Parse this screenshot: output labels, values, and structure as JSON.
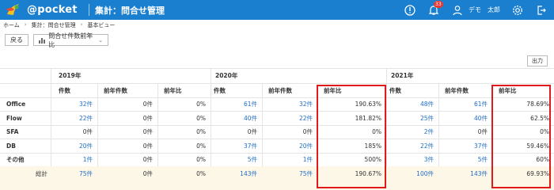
{
  "header": {
    "logo_text": "@pocket",
    "title": "集計：問合せ管理",
    "badge_count": "33",
    "user_name": "デモ　太郎"
  },
  "breadcrumb": [
    "ホーム",
    "集計：問合せ管理",
    "基本ビュー"
  ],
  "toolbar": {
    "back_label": "戻る",
    "dropdown_value": "問合せ件数前年比",
    "export_label": "出力"
  },
  "years": [
    "2019年",
    "2020年",
    "2021年"
  ],
  "column_headers": [
    "件数",
    "前年件数",
    "前年比"
  ],
  "rows": [
    {
      "label": "Office",
      "y2019": [
        "32件",
        "0件",
        "0%"
      ],
      "y2020": [
        "61件",
        "32件",
        "190.63%"
      ],
      "y2021": [
        "48件",
        "61件",
        "78.69%"
      ]
    },
    {
      "label": "Flow",
      "y2019": [
        "22件",
        "0件",
        "0%"
      ],
      "y2020": [
        "40件",
        "22件",
        "181.82%"
      ],
      "y2021": [
        "25件",
        "40件",
        "62.5%"
      ]
    },
    {
      "label": "SFA",
      "y2019": [
        "0件",
        "0件",
        "0%"
      ],
      "y2020": [
        "0件",
        "0件",
        "0%"
      ],
      "y2021": [
        "2件",
        "0件",
        "0%"
      ]
    },
    {
      "label": "DB",
      "y2019": [
        "20件",
        "0件",
        "0%"
      ],
      "y2020": [
        "37件",
        "20件",
        "185%"
      ],
      "y2021": [
        "22件",
        "37件",
        "59.46%"
      ]
    },
    {
      "label": "その他",
      "y2019": [
        "1件",
        "0件",
        "0%"
      ],
      "y2020": [
        "5件",
        "1件",
        "500%"
      ],
      "y2021": [
        "3件",
        "5件",
        "60%"
      ]
    }
  ],
  "total": {
    "label": "総計",
    "y2019": [
      "75件",
      "0件",
      "0%"
    ],
    "y2020": [
      "143件",
      "75件",
      "190.67%"
    ],
    "y2021": [
      "100件",
      "143件",
      "69.93%"
    ]
  },
  "colors": {
    "header_blue": "#1a7fcf",
    "highlight_red": "#e0191c",
    "total_row_bg": "#fdf7e8",
    "link_blue": "#1f6cc5"
  }
}
